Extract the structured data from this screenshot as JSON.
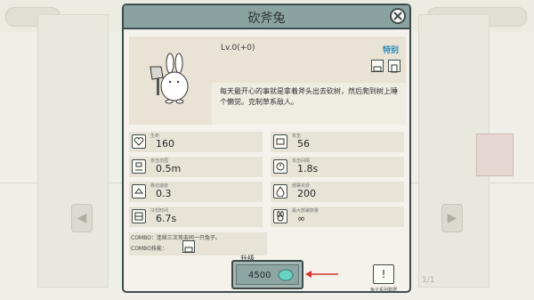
{
  "dialog": {
    "title": "砍斧兔",
    "level": "Lv.0(+0)",
    "special_tag": "特别",
    "description": "每天最开心的事就是拿着斧头出去砍树，然后爬到树上睡个懒觉。克制草系敌人。"
  },
  "stats": [
    {
      "label": "生命",
      "value": "160",
      "icon": "heart-icon"
    },
    {
      "label": "攻击",
      "value": "56",
      "icon": "attack-icon"
    },
    {
      "label": "攻击范围",
      "value": "0.5m",
      "icon": "range-icon"
    },
    {
      "label": "攻击间隔",
      "value": "1.8s",
      "icon": "interval-icon"
    },
    {
      "label": "移动速度",
      "value": "0.3",
      "icon": "speed-icon"
    },
    {
      "label": "部署花费",
      "value": "200",
      "icon": "cost-icon"
    },
    {
      "label": "冷却时间",
      "value": "6.7s",
      "icon": "cooldown-icon"
    },
    {
      "label": "最大部署数量",
      "value": "∞",
      "icon": "max-deploy-icon"
    }
  ],
  "combo": {
    "line1": "COMBO：连续三次攻击同一只兔子。",
    "line2": "COMBO技能："
  },
  "upgrade": {
    "label": "升级",
    "cost": "4500"
  },
  "info": {
    "label": "兔子系列数据"
  },
  "background": {
    "pager": "1/1"
  },
  "colors": {
    "title_bar": "#8aa3a0",
    "border": "#3e4b4c",
    "special_tag": "#2a88b8",
    "gem": "#68d3c3",
    "annotation_arrow": "#d9322f"
  }
}
